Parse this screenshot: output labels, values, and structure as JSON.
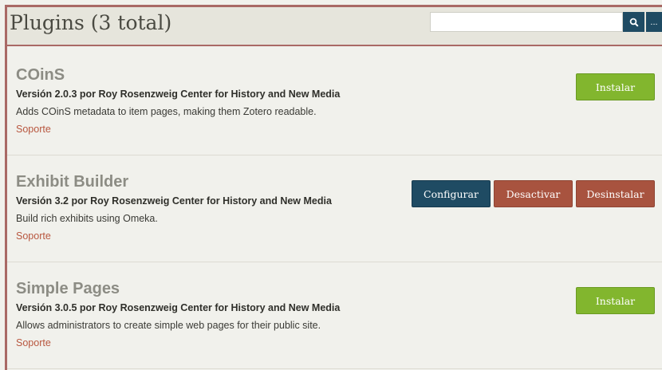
{
  "header": {
    "title": "Plugins (3 total)",
    "search_placeholder": "",
    "search_value": "",
    "more_label": "..."
  },
  "plugins": [
    {
      "name": "COinS",
      "version": "Versión 2.0.3 por Roy Rosenzweig Center for History and New Media",
      "description": "Adds COinS metadata to item pages, making them Zotero readable.",
      "support_label": "Soporte",
      "actions": [
        "Instalar"
      ]
    },
    {
      "name": "Exhibit Builder",
      "version": "Versión 3.2 por Roy Rosenzweig Center for History and New Media",
      "description": "Build rich exhibits using Omeka.",
      "support_label": "Soporte",
      "actions": [
        "Configurar",
        "Desactivar",
        "Desinstalar"
      ]
    },
    {
      "name": "Simple Pages",
      "version": "Versión 3.0.5 por Roy Rosenzweig Center for History and New Media",
      "description": "Allows administrators to create simple web pages for their public site.",
      "support_label": "Soporte",
      "actions": [
        "Instalar"
      ]
    }
  ],
  "colors": {
    "accent_border": "#a96965",
    "install_green": "#82b62e",
    "configure_blue": "#1f4b63",
    "danger_red": "#a8533f",
    "support_link": "#b8573f"
  },
  "icons": {
    "search": "search-icon"
  }
}
